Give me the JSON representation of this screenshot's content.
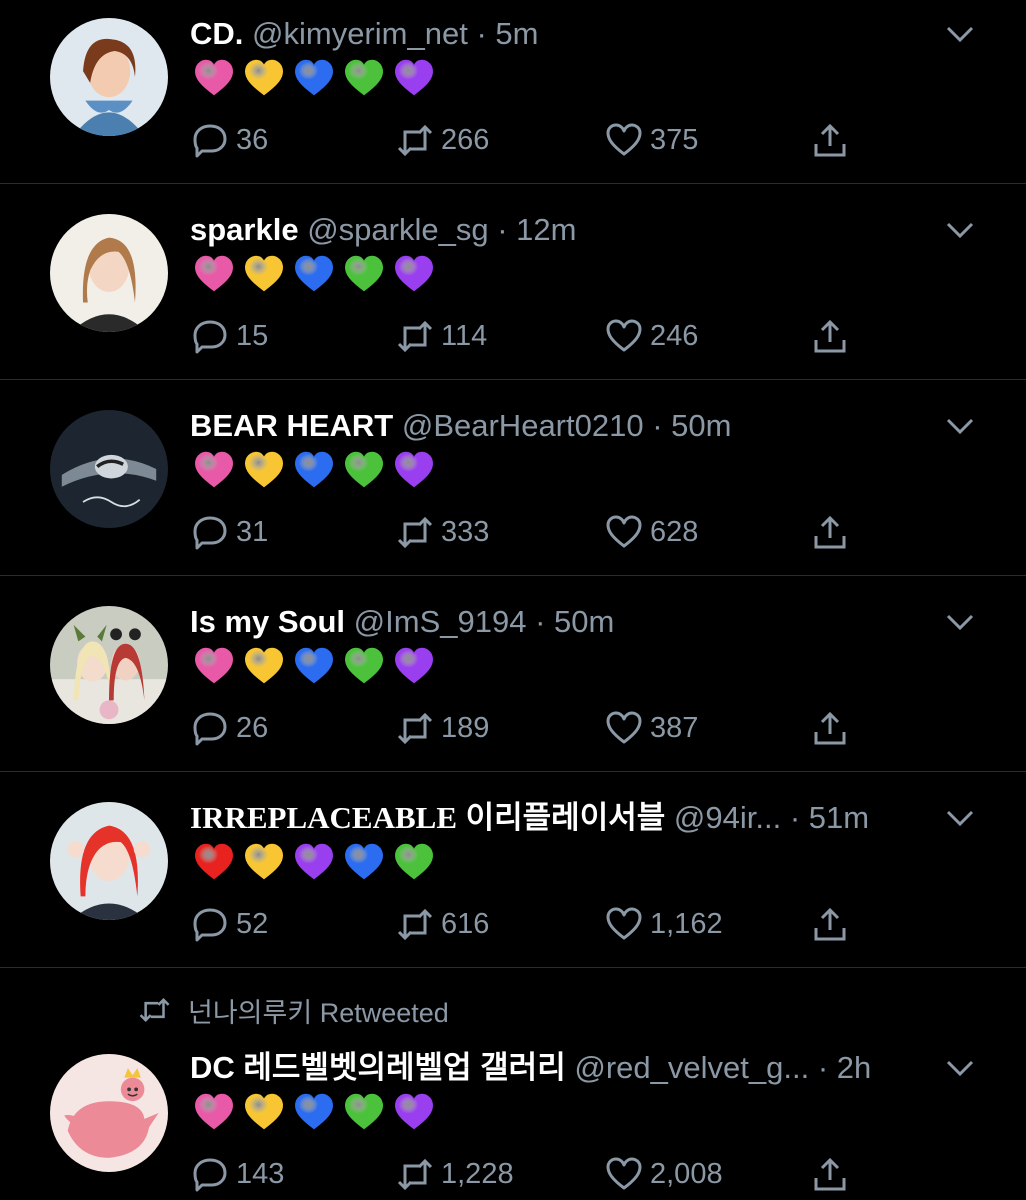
{
  "tweets": [
    {
      "display_name": "CD.",
      "name_extra": "",
      "handle": "@kimyerim_net",
      "dot": "·",
      "time": "5m",
      "hearts": [
        "pink",
        "yellow",
        "blue",
        "green",
        "purple"
      ],
      "replies": "36",
      "retweets": "266",
      "likes": "375",
      "avatar": "avatar-woman-denim"
    },
    {
      "display_name": "sparkle",
      "name_extra": "",
      "handle": "@sparkle_sg",
      "dot": "·",
      "time": "12m",
      "hearts": [
        "pink",
        "yellow",
        "blue",
        "green",
        "purple"
      ],
      "replies": "15",
      "retweets": "114",
      "likes": "246",
      "avatar": "avatar-woman-light"
    },
    {
      "display_name": "BEAR HEART",
      "name_extra": "",
      "handle": "@BearHeart0210",
      "dot": "·",
      "time": "50m",
      "hearts": [
        "pink",
        "yellow",
        "blue",
        "green",
        "purple"
      ],
      "replies": "31",
      "retweets": "333",
      "likes": "628",
      "avatar": "avatar-bear-heart-logo"
    },
    {
      "display_name": "Is my Soul",
      "name_extra": "",
      "handle": "@ImS_9194",
      "dot": "·",
      "time": "50m",
      "hearts": [
        "pink",
        "yellow",
        "blue",
        "green",
        "purple"
      ],
      "replies": "26",
      "retweets": "189",
      "likes": "387",
      "avatar": "avatar-two-women"
    },
    {
      "display_name": "IRREPLACEABLE",
      "name_extra": "이리플레이서블",
      "handle": "@94ir...",
      "dot": "·",
      "time": "51m",
      "hearts": [
        "red",
        "yellow",
        "purple",
        "blue",
        "green"
      ],
      "replies": "52",
      "retweets": "616",
      "likes": "1,162",
      "avatar": "avatar-red-hair-woman"
    },
    {
      "display_name": "DC 레드벨벳의레벨업 갤러리",
      "name_extra": "",
      "handle": "@red_velvet_g...",
      "dot": "·",
      "time": "2h",
      "hearts": [
        "pink",
        "yellow",
        "blue",
        "green",
        "purple"
      ],
      "replies": "143",
      "retweets": "1,228",
      "likes": "2,008",
      "avatar": "avatar-pink-bird",
      "retweeted_by": "넌나의루키 Retweeted"
    }
  ],
  "colors": {
    "background": "#000000",
    "text_primary": "#ffffff",
    "text_secondary": "#8b98a5",
    "divider": "#2a2d30",
    "heart_pink": "#e85aa8",
    "heart_yellow": "#f7c632",
    "heart_blue": "#2b6cf0",
    "heart_green": "#4cc23c",
    "heart_purple": "#9a3ff0",
    "heart_red": "#e8231f"
  },
  "icons": {
    "reply": "reply-bubble-icon",
    "retweet": "retweet-arrows-icon",
    "like": "like-heart-icon",
    "share": "share-upload-icon",
    "caret": "chevron-down-icon"
  }
}
